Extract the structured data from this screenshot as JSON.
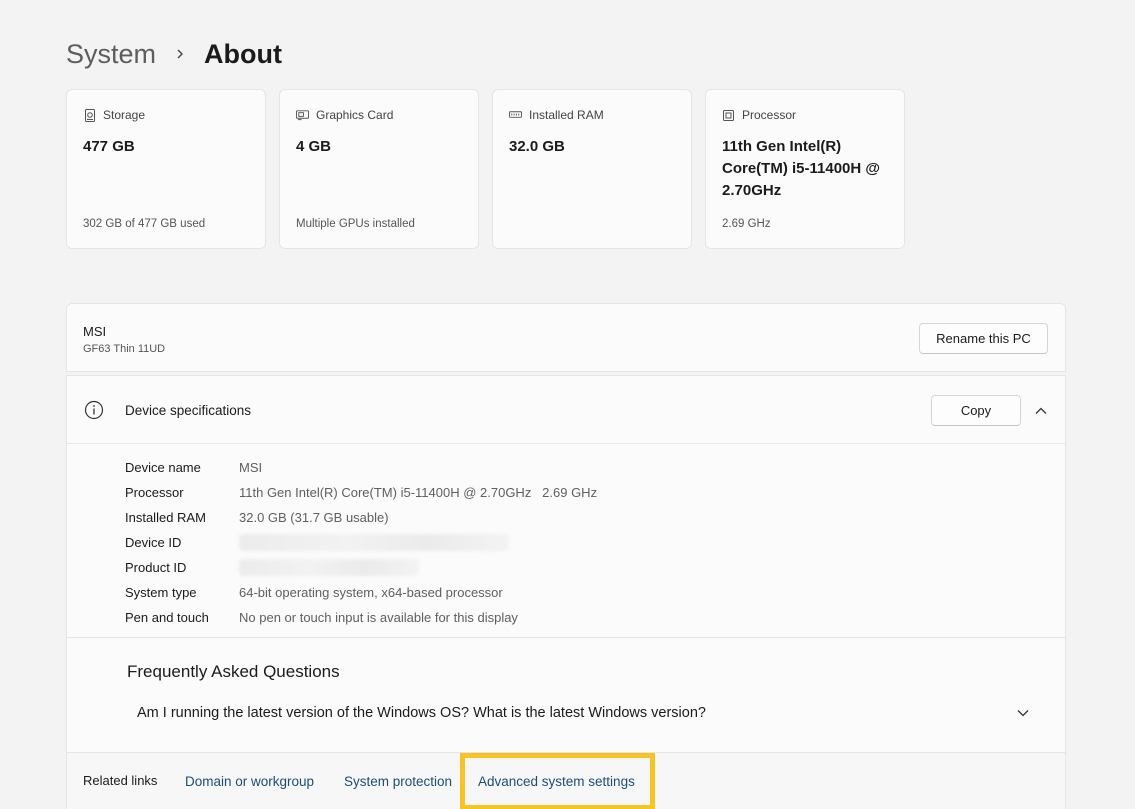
{
  "breadcrumb": {
    "parent": "System",
    "current": "About"
  },
  "cards": [
    {
      "icon": "storage-icon",
      "label": "Storage",
      "value": "477 GB",
      "sub": "302 GB of 477 GB used"
    },
    {
      "icon": "graphics-card-icon",
      "label": "Graphics Card",
      "value": "4 GB",
      "sub": "Multiple GPUs installed"
    },
    {
      "icon": "ram-icon",
      "label": "Installed RAM",
      "value": "32.0 GB",
      "sub": ""
    },
    {
      "icon": "processor-icon",
      "label": "Processor",
      "value": "11th Gen Intel(R) Core(TM) i5-11400H @ 2.70GHz",
      "sub": "2.69 GHz"
    }
  ],
  "pc": {
    "name": "MSI",
    "model": "GF63 Thin 11UD",
    "rename_label": "Rename this PC"
  },
  "specs": {
    "title": "Device specifications",
    "copy_label": "Copy",
    "rows": [
      {
        "label": "Device name",
        "value": "MSI"
      },
      {
        "label": "Processor",
        "value": "11th Gen Intel(R) Core(TM) i5-11400H @ 2.70GHz   2.69 GHz"
      },
      {
        "label": "Installed RAM",
        "value": "32.0 GB (31.7 GB usable)"
      },
      {
        "label": "Device ID",
        "value": ""
      },
      {
        "label": "Product ID",
        "value": ""
      },
      {
        "label": "System type",
        "value": "64-bit operating system, x64-based processor"
      },
      {
        "label": "Pen and touch",
        "value": "No pen or touch input is available for this display"
      }
    ]
  },
  "faq": {
    "title": "Frequently Asked Questions",
    "question": "Am I running the latest version of the Windows OS? What is the latest Windows version?"
  },
  "related": {
    "label": "Related links",
    "links": [
      "Domain or workgroup",
      "System protection",
      "Advanced system settings"
    ]
  },
  "colors": {
    "highlight": "#f7c325",
    "link": "#1a4d7a"
  }
}
